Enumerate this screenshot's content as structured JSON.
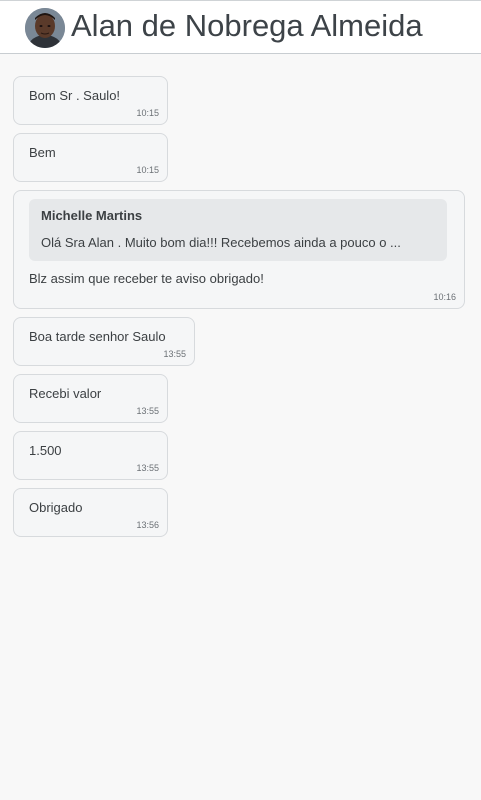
{
  "header": {
    "contact_name": "Alan de Nobrega Almeida",
    "avatar_icon": "contact-avatar"
  },
  "messages": [
    {
      "text": "Bom Sr . Saulo!",
      "time": "10:15"
    },
    {
      "text": "Bem",
      "time": "10:15"
    },
    {
      "quoted": {
        "author": "Michelle Martins",
        "text": "Olá Sra Alan . Muito bom dia!!! Recebemos ainda a pouco o ..."
      },
      "text": "Blz assim que receber te aviso obrigado!",
      "time": "10:16"
    },
    {
      "text": "Boa tarde senhor Saulo",
      "time": "13:55"
    },
    {
      "text": "Recebi valor",
      "time": "13:55"
    },
    {
      "text": "1.500",
      "time": "13:55"
    },
    {
      "text": "Obrigado",
      "time": "13:56"
    }
  ],
  "colors": {
    "bubble_bg": "#f5f6f7",
    "bubble_border": "#d7dadd",
    "quote_bg": "#e6e8ea",
    "text": "#3c4043"
  }
}
